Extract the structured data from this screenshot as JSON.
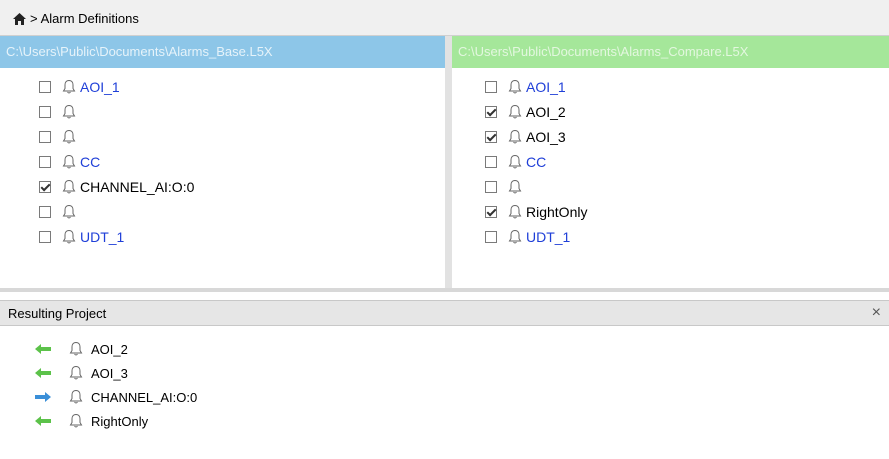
{
  "breadcrumb": {
    "home_icon": "home-icon",
    "separator": ">",
    "title": "Alarm Definitions"
  },
  "left_pane": {
    "path": "C:\\Users\\Public\\Documents\\Alarms_Base.L5X",
    "header_color": "#8dc6e8",
    "items": [
      {
        "label": "AOI_1",
        "checked": false,
        "link": true
      },
      {
        "label": "",
        "checked": false,
        "link": false
      },
      {
        "label": "",
        "checked": false,
        "link": false
      },
      {
        "label": "CC",
        "checked": false,
        "link": true
      },
      {
        "label": "CHANNEL_AI:O:0",
        "checked": true,
        "link": false
      },
      {
        "label": "",
        "checked": false,
        "link": false
      },
      {
        "label": "UDT_1",
        "checked": false,
        "link": true
      }
    ]
  },
  "right_pane": {
    "path": "C:\\Users\\Public\\Documents\\Alarms_Compare.L5X",
    "header_color": "#a5e79a",
    "items": [
      {
        "label": "AOI_1",
        "checked": false,
        "link": true
      },
      {
        "label": "AOI_2",
        "checked": true,
        "link": false
      },
      {
        "label": "AOI_3",
        "checked": true,
        "link": false
      },
      {
        "label": "CC",
        "checked": false,
        "link": true
      },
      {
        "label": "",
        "checked": false,
        "link": false
      },
      {
        "label": "RightOnly",
        "checked": true,
        "link": false
      },
      {
        "label": "UDT_1",
        "checked": false,
        "link": true
      }
    ]
  },
  "result": {
    "title": "Resulting Project",
    "close": "×",
    "items": [
      {
        "label": "AOI_2",
        "direction": "left",
        "color": "#5cc24a"
      },
      {
        "label": "AOI_3",
        "direction": "left",
        "color": "#5cc24a"
      },
      {
        "label": "CHANNEL_AI:O:0",
        "direction": "right",
        "color": "#3a8fd8"
      },
      {
        "label": "RightOnly",
        "direction": "left",
        "color": "#5cc24a"
      }
    ]
  }
}
